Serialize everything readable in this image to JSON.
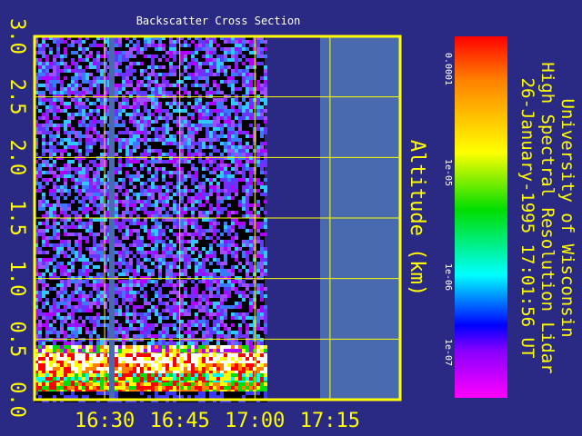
{
  "chart_data": {
    "type": "heatmap",
    "title": "Backscatter Cross Section",
    "xlabel": "",
    "ylabel": "Altitude (km)",
    "x_ticks": [
      "16:30",
      "16:45",
      "17:00",
      "17:15"
    ],
    "y_ticks": [
      "0.0",
      "0.5",
      "1.0",
      "1.5",
      "2.0",
      "2.5",
      "3.0"
    ],
    "xlim": [
      "16:16",
      "17:29"
    ],
    "ylim": [
      0.0,
      3.0
    ],
    "data_end_time": "17:02",
    "data_gap_time": "16:31",
    "colorbar": {
      "labels": [
        "0.0001",
        "1e-05",
        "1e-06",
        "1e-07"
      ],
      "scale": "log",
      "colors": [
        "#ff0000",
        "#ff8000",
        "#ffff00",
        "#00dd00",
        "#00ffff",
        "#0000ff",
        "#ff00ff"
      ]
    },
    "grid": true
  },
  "header": {
    "line1": "University of Wisconsin",
    "line2": "High Spectral Resolution Lidar",
    "line3": "26-January-1995 17:01:56 UT"
  },
  "colors": {
    "background": "#2a2a84",
    "frame": "#ffff00",
    "no_data": "#4a6ab0"
  }
}
